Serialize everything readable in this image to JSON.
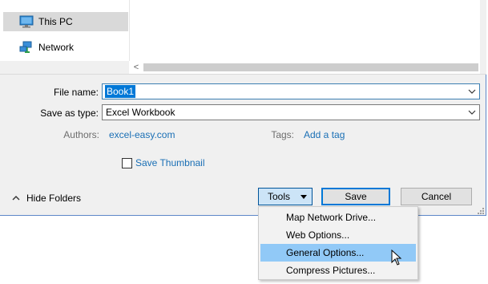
{
  "nav": {
    "items": [
      {
        "label": "This PC",
        "icon": "monitor-icon",
        "selected": true
      },
      {
        "label": "Network",
        "icon": "network-icon",
        "selected": false
      }
    ]
  },
  "hscroll": {
    "left_arrow": "<"
  },
  "form": {
    "filename_label": "File name:",
    "filename_value": "Book1",
    "savetype_label": "Save as type:",
    "savetype_value": "Excel Workbook",
    "authors_label": "Authors:",
    "authors_value": "excel-easy.com",
    "tags_label": "Tags:",
    "tags_value": "Add a tag",
    "thumbnail_label": "Save Thumbnail",
    "thumbnail_checked": false
  },
  "footer": {
    "hide_folders_label": "Hide Folders",
    "tools_label": "Tools",
    "save_label": "Save",
    "cancel_label": "Cancel"
  },
  "tools_menu": {
    "items": [
      {
        "label": "Map Network Drive...",
        "highlighted": false
      },
      {
        "label": "Web Options...",
        "highlighted": false
      },
      {
        "label": "General Options...",
        "highlighted": true
      },
      {
        "label": "Compress Pictures...",
        "highlighted": false
      }
    ]
  },
  "colors": {
    "accent": "#0078d7",
    "link": "#1a6fb5",
    "menu_highlight": "#91c9f7"
  }
}
